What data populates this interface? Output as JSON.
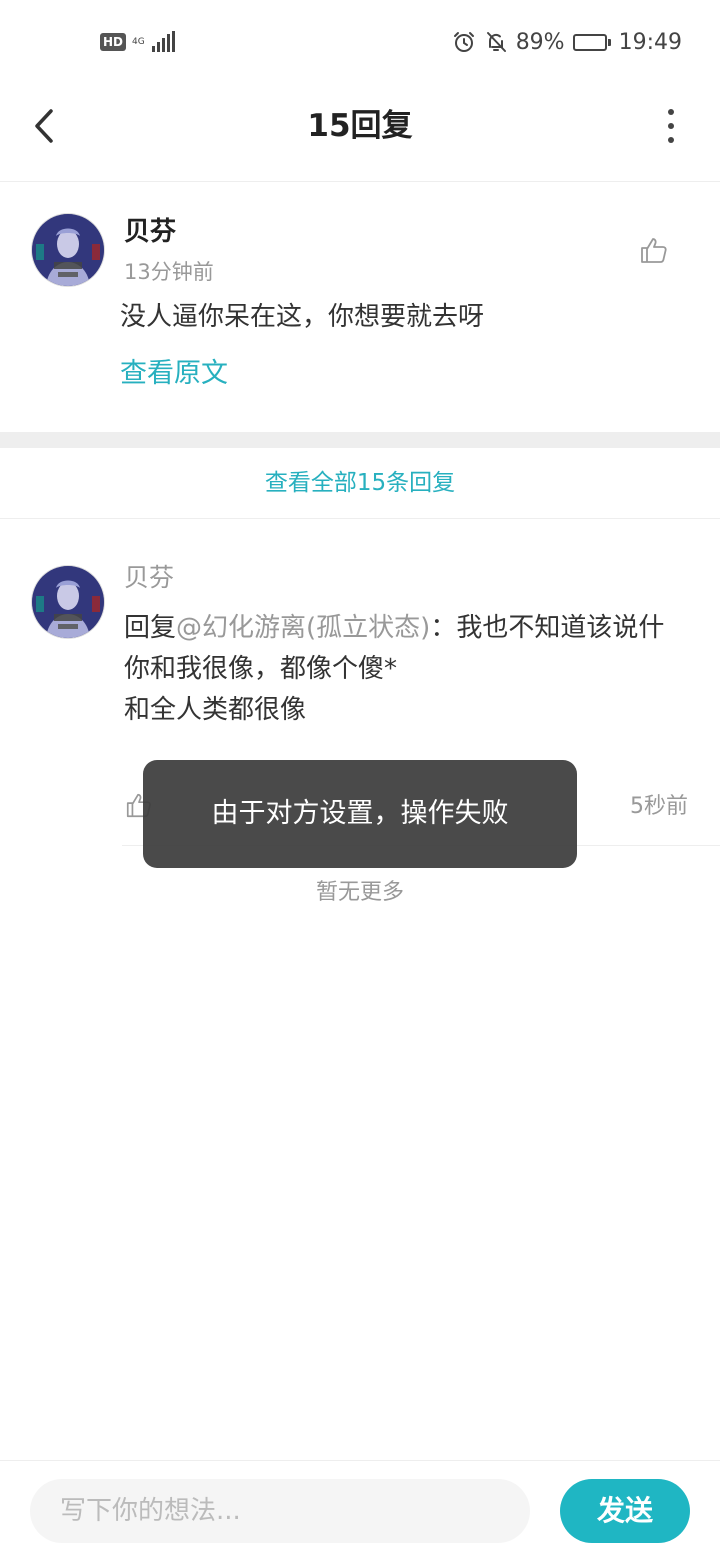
{
  "status_bar": {
    "hd": "HD",
    "network": "4G",
    "battery_percent": "89%",
    "battery_level": 0.89,
    "time": "19:49",
    "icons": [
      "alarm-icon",
      "bell-off-icon",
      "battery-icon",
      "signal-icon"
    ]
  },
  "header": {
    "title": "15回复",
    "back_icon": "chevron-left-icon",
    "more_icon": "more-vertical-icon"
  },
  "main_comment": {
    "author": "贝芬",
    "time": "13分钟前",
    "text": "没人逼你呆在这，你想要就去呀",
    "view_original": "查看原文"
  },
  "view_all_replies": "查看全部15条回复",
  "reply": {
    "author": "贝芬",
    "prefix": "回复",
    "mention": "@幻化游离(孤立状态)",
    "line1_rest": "：我也不知道该说什",
    "line2": "你和我很像，都像个傻*",
    "line3": "和全人类都很像",
    "time": "5秒前"
  },
  "no_more": "暂无更多",
  "toast": "由于对方设置，操作失败",
  "bottom_bar": {
    "placeholder": "写下你的想法...",
    "send": "发送"
  },
  "colors": {
    "accent": "#27b0bf",
    "send_button": "#1fb6c3",
    "toast_bg": "#3c3c3c"
  }
}
